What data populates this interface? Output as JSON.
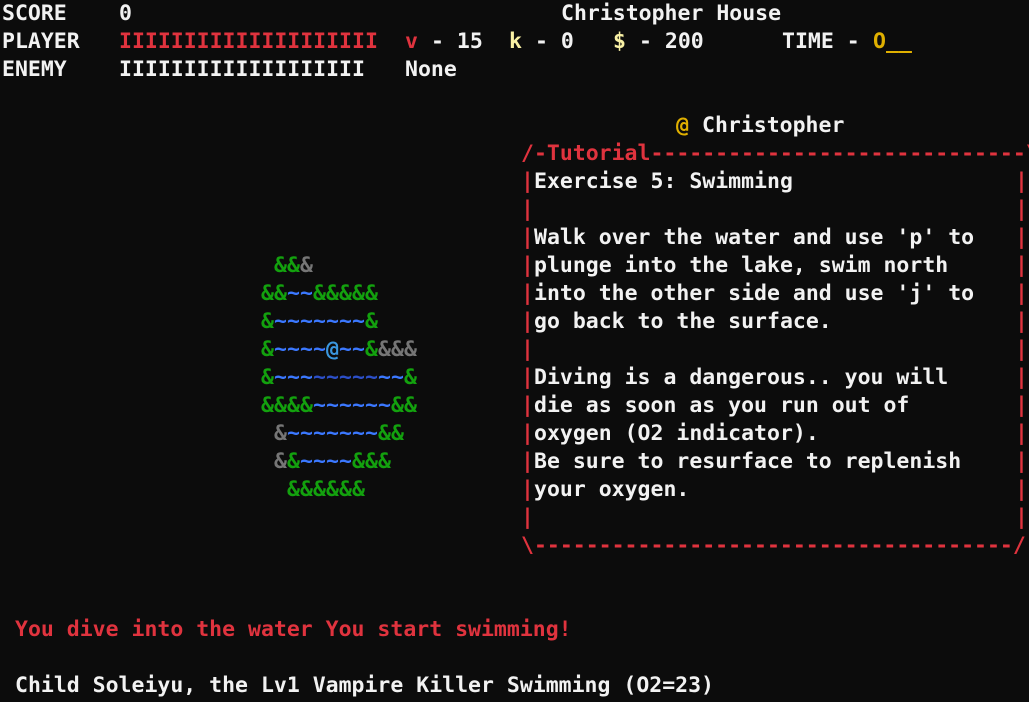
{
  "hud": {
    "score_label": "SCORE",
    "score_value": "0",
    "location": "Christopher House",
    "player_label": "PLAYER",
    "player_health_bar": "IIIIIIIIIIIIIIIIIIII",
    "v_label": "v",
    "v_value": "- 15",
    "k_label": "k",
    "k_value": "- 0",
    "money_label": "$",
    "money_value": "- 200",
    "time_label": "TIME -",
    "time_value": "O",
    "time_suffix": "__",
    "enemy_label": "ENEMY",
    "enemy_health_bar": "IIIIIIIIIIIIIIIIIII",
    "enemy_name": "None"
  },
  "npc_header": {
    "glyph": "@",
    "name": "Christopher"
  },
  "dialog": {
    "top_border": "/-Tutorial-----------------------------\\",
    "left_border": "|",
    "right_border": "|",
    "bottom_border": "\\-------------------------------------/",
    "lines": [
      "Exercise 5: Swimming",
      "",
      "Walk over the water and use 'p' to",
      "plunge into the lake, swim north",
      "into the other side and use 'j' to",
      "go back to the surface.",
      "",
      "Diving is a dangerous.. you will",
      "die as soon as you run out of",
      "oxygen (O2 indicator).",
      "Be sure to resurface to replenish",
      "your oxygen.",
      ""
    ]
  },
  "map": {
    "rows": [
      " &&&",
      "&&~~&&&&&",
      "&~~~~~~~&",
      "&~~~~@~~&&&&",
      "&~~~~~~~~~~&",
      "&&&&~~~~~~&&",
      " &~~~~~~~&&",
      " &&~~~~&&&",
      "  &&&&&&"
    ]
  },
  "messages": {
    "log": "You dive into the water You start swimming!"
  },
  "status_line": "Child Soleiyu, the Lv1 Vampire Killer Swimming (O2=23)"
}
